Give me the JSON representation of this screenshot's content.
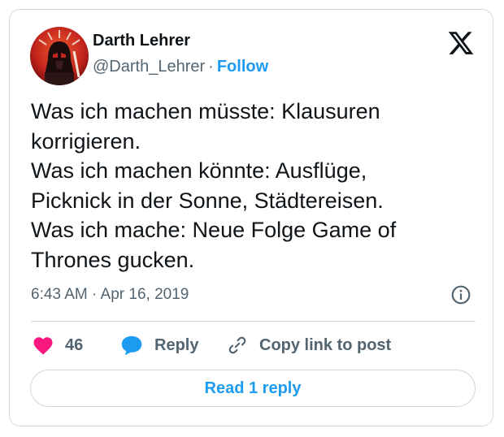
{
  "author": {
    "display_name": "Darth Lehrer",
    "handle": "@Darth_Lehrer",
    "separator": "·",
    "follow_label": "Follow",
    "avatar_icon": "darth-vader-avatar-icon"
  },
  "platform_icon": "x-logo-icon",
  "tweet": {
    "lines": [
      "Was ich machen müsste: Klausuren",
      "korrigieren.",
      "Was ich machen könnte: Ausflüge,",
      "Picknick in der Sonne, Städtereisen.",
      "Was ich mache: Neue Folge Game of",
      "Thrones gucken."
    ],
    "timestamp": "6:43 AM · Apr 16, 2019"
  },
  "actions": {
    "like_count": "46",
    "reply_label": "Reply",
    "copy_link_label": "Copy link to post"
  },
  "read_replies_label": "Read 1 reply",
  "colors": {
    "text": "#0f1419",
    "muted": "#536471",
    "accent": "#1d9bf0",
    "heart": "#f91880",
    "border": "#cfd9de"
  }
}
